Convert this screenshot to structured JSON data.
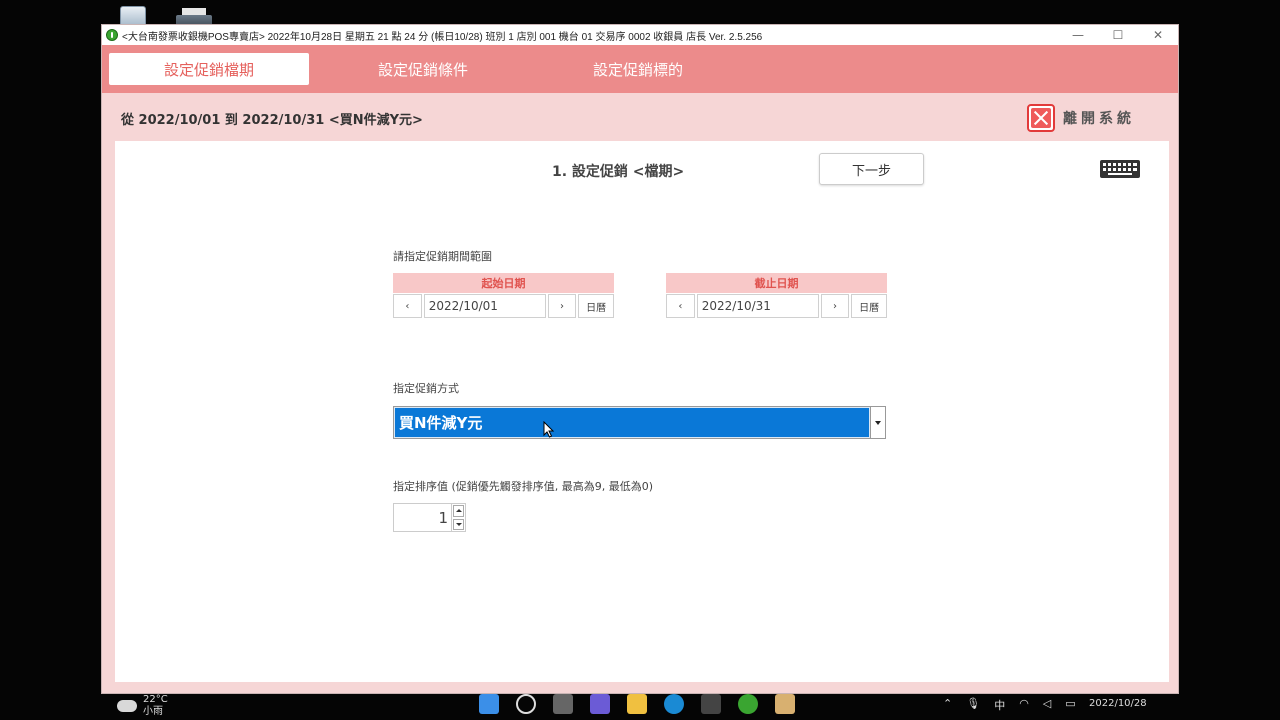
{
  "window": {
    "title": "<大台南發票收銀機POS專賣店> 2022年10月28日 星期五 21 點 24 分 (帳日10/28) 班別 1 店別 001 機台 01 交易序 0002 收銀員 店長  Ver. 2.5.256",
    "minimize": "—",
    "maximize": "☐",
    "close": "✕"
  },
  "tabs": [
    {
      "label": "設定促銷檔期"
    },
    {
      "label": "設定促銷條件"
    },
    {
      "label": "設定促銷標的"
    }
  ],
  "summary": "從 2022/10/01 到 2022/10/31 <買N件減Y元>",
  "exit_label": "離開系統",
  "step_title": "1. 設定促銷 <檔期>",
  "next_button": "下一步",
  "period": {
    "label": "請指定促銷期間範圍",
    "start": {
      "header": "起始日期",
      "value": "2022/10/01",
      "prev": "‹",
      "next": "›",
      "calendar": "日曆"
    },
    "end": {
      "header": "截止日期",
      "value": "2022/10/31",
      "prev": "‹",
      "next": "›",
      "calendar": "日曆"
    }
  },
  "method": {
    "label": "指定促銷方式",
    "selected": "買N件減Y元"
  },
  "priority": {
    "label": "指定排序值 (促銷優先觸發排序值, 最高為9, 最低為0)",
    "value": "1"
  },
  "taskbar": {
    "weather_line1": "22°C",
    "weather_line2": "小雨",
    "ime": "中",
    "date": "2022/10/28"
  },
  "colors": {
    "tab_bar": "#ec8b8b",
    "window_bg": "#f6d6d6",
    "accent_red": "#e23a3a",
    "select_blue": "#0a78d7"
  }
}
